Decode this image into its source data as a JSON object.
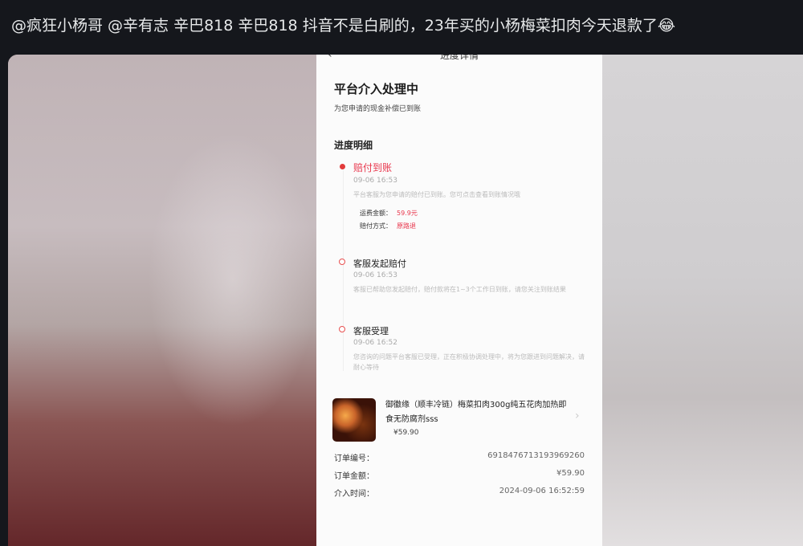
{
  "tweet": {
    "text": "@疯狂小杨哥 @辛有志 辛巴818 辛巴818 抖音不是白刷的，23年买的小杨梅菜扣肉今天退款了😂"
  },
  "phone": {
    "nav_title": "进度详情",
    "heading": "平台介入处理中",
    "subheading": "为您申请的现金补偿已到账",
    "progress_title": "进度明细",
    "steps": [
      {
        "title": "赔付到账",
        "time": "09-06 16:53",
        "desc": "平台客服为您申请的赔付已到账。您可点击查看到账情况哦",
        "amount_label": "运费金额：",
        "amount_value": "59.9元",
        "method_label": "赔付方式：",
        "method_value": "原路退"
      },
      {
        "title": "客服发起赔付",
        "time": "09-06 16:53",
        "desc": "客服已帮助您发起赔付，赔付款将在1~3个工作日到账，请您关注到账结果"
      },
      {
        "title": "客服受理",
        "time": "09-06 16:52",
        "desc": "您咨询的问题平台客服已受理，正在积极协调处理中，将为您跟进到问题解决，请耐心等待"
      }
    ],
    "product": {
      "name": "御徽缘（顺丰冷链）梅菜扣肉300g纯五花肉加热即食无防腐剂sss",
      "price": "¥59.90"
    },
    "order": [
      {
        "label": "订单编号：",
        "value": "6918476713193969260"
      },
      {
        "label": "订单金额：",
        "value": "¥59.90"
      },
      {
        "label": "介入时间：",
        "value": "2024-09-06 16:52:59"
      }
    ]
  }
}
